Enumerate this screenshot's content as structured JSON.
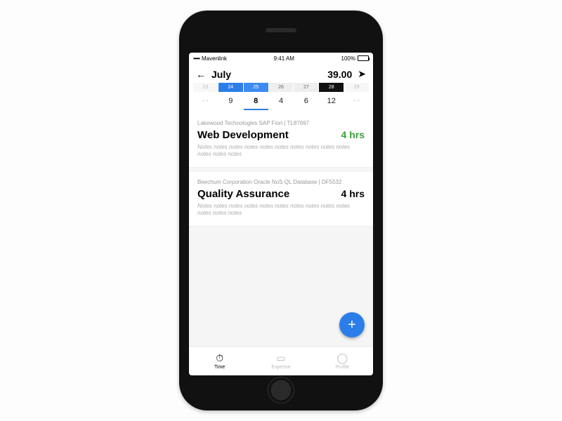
{
  "statusbar": {
    "carrier": "Mavenlink",
    "time": "9:41 AM",
    "battery": "100%"
  },
  "header": {
    "month": "July",
    "total": "39.00"
  },
  "week": {
    "days": [
      "23",
      "24",
      "25",
      "26",
      "27",
      "28",
      "29"
    ],
    "hours": [
      "- -",
      "9",
      "8",
      "4",
      "6",
      "12",
      "- -"
    ],
    "selectedIndex": 2
  },
  "cards": [
    {
      "project": "Lakewood Technologies SAP Fiori | TL87697",
      "task": "Web Development",
      "hours": "4 hrs",
      "hoursColor": "green",
      "notes": "Notes notes notes notes notes notes notes notes notes notes notes notes notes"
    },
    {
      "project": "Beechum Corporation Oracle NoS QL Database | DF5532",
      "task": "Quality Assurance",
      "hours": "4 hrs",
      "hoursColor": "default",
      "notes": "Notes notes notes notes notes notes notes notes notes notes notes notes notes"
    }
  ],
  "fab": {
    "label": "+"
  },
  "tabs": [
    {
      "icon": "⏱",
      "label": "Time",
      "active": true
    },
    {
      "icon": "▭",
      "label": "Expense",
      "active": false
    },
    {
      "icon": "◯",
      "label": "Profile",
      "active": false
    }
  ]
}
